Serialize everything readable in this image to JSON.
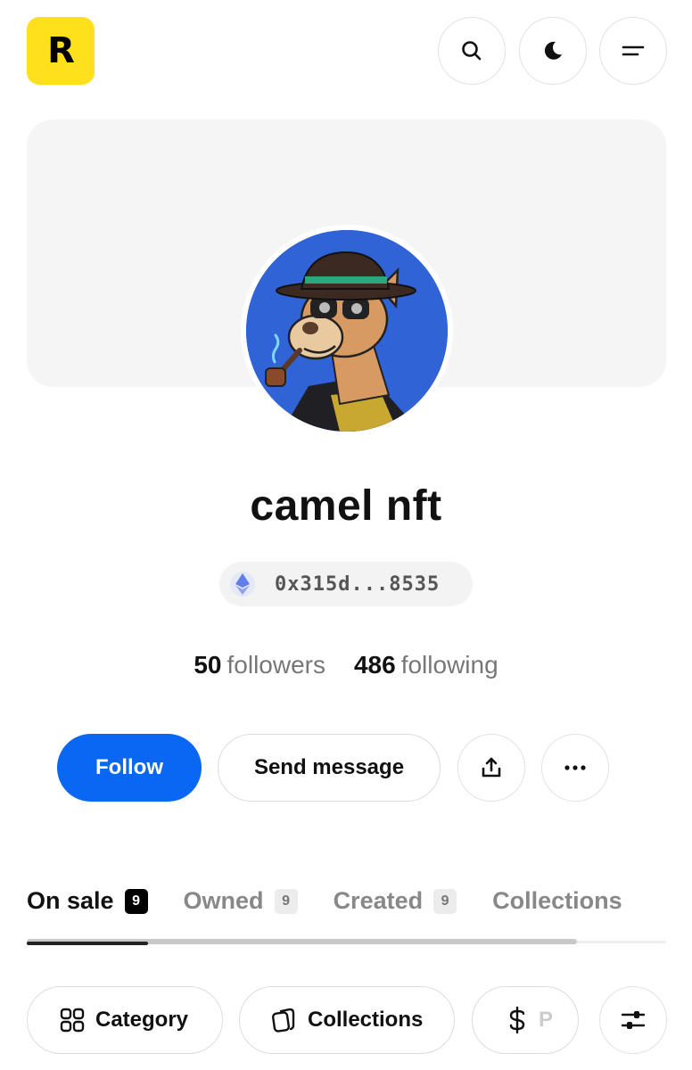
{
  "header": {
    "logo_letter": "R",
    "brand_color": "#FFE01B",
    "icons": [
      "search-icon",
      "moon-icon",
      "menu-icon"
    ]
  },
  "profile": {
    "name": "camel nft",
    "address": "0x315d...8535",
    "chain_icon": "ethereum-icon",
    "followers_count": "50",
    "followers_label": "followers",
    "following_count": "486",
    "following_label": "following"
  },
  "actions": {
    "follow_label": "Follow",
    "follow_color": "#0a67f2",
    "message_label": "Send message",
    "share_icon": "share-icon",
    "more_icon": "more-icon"
  },
  "tabs": [
    {
      "label": "On sale",
      "count": "9",
      "active": true
    },
    {
      "label": "Owned",
      "count": "9",
      "active": false
    },
    {
      "label": "Created",
      "count": "9",
      "active": false
    },
    {
      "label": "Collections",
      "count": "",
      "active": false
    }
  ],
  "filters": {
    "category_label": "Category",
    "collections_label": "Collections",
    "price_label": "P",
    "filter_icon": "sliders-icon"
  }
}
